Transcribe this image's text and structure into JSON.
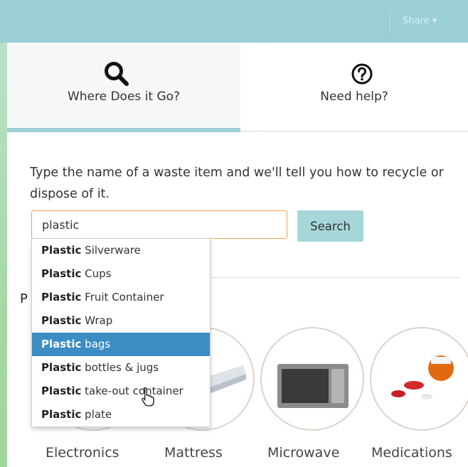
{
  "header": {
    "share_label": "Share ▾"
  },
  "tabs": [
    {
      "label": "Where Does it Go?",
      "icon": "search-icon",
      "active": true
    },
    {
      "label": "Need help?",
      "icon": "question-icon",
      "active": false
    }
  ],
  "intro_text": "Type the name of a waste item and we'll tell you how to recycle or dispose of it.",
  "search": {
    "value": "plastic",
    "button_label": "Search"
  },
  "autocomplete": {
    "highlight": "Plastic",
    "items": [
      {
        "rest": "Silverware",
        "active": false
      },
      {
        "rest": "Cups",
        "active": false
      },
      {
        "rest": "Fruit Container",
        "active": false
      },
      {
        "rest": "Wrap",
        "active": false
      },
      {
        "rest": "bags",
        "active": true
      },
      {
        "rest": "bottles & jugs",
        "active": false
      },
      {
        "rest": "take-out container",
        "active": false
      },
      {
        "rest": "plate",
        "active": false
      }
    ]
  },
  "section_heading_visible": "P",
  "categories": [
    {
      "label": "Electronics"
    },
    {
      "label": "Mattress"
    },
    {
      "label": "Microwave"
    },
    {
      "label": "Medications"
    }
  ],
  "colors": {
    "tab_accent": "#9dcfd8",
    "input_focus_border": "#f0a050",
    "dropdown_active": "#3b8dc4",
    "search_button": "#a7d6d9"
  }
}
